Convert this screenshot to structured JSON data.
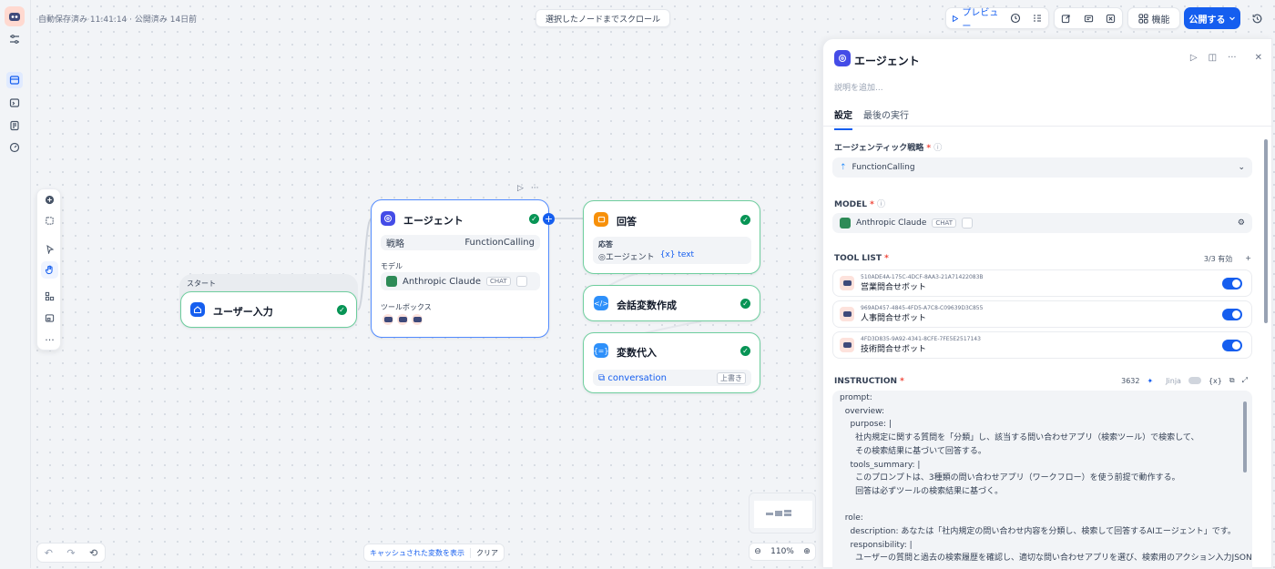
{
  "status": {
    "autosave": "自動保存済み 11:41:14 · 公開済み 14日前"
  },
  "scroll_button": "選択したノードまでスクロール",
  "toolbar": {
    "preview": "プレビュー",
    "features": "機能",
    "publish": "公開する"
  },
  "nodes": {
    "start": {
      "group_label": "スタート",
      "title": "ユーザー入力"
    },
    "agent": {
      "title": "エージェント",
      "strategy_label": "戦略",
      "strategy_value": "FunctionCalling",
      "model_label": "モデル",
      "model_name": "Anthropic Claude",
      "model_tag": "CHAT",
      "toolbox_label": "ツールボックス"
    },
    "answer": {
      "title": "回答",
      "response_label": "応答",
      "ref_node": "エージェント",
      "ref_var": "text"
    },
    "conv_create": {
      "title": "会話変数作成"
    },
    "assign": {
      "title": "変数代入",
      "var": "conversation",
      "mode": "上書き"
    }
  },
  "panel": {
    "title": "エージェント",
    "description_placeholder": "説明を追加...",
    "tabs": [
      "設定",
      "最後の実行"
    ],
    "strategy_label": "エージェンティック戦略",
    "strategy_value": "FunctionCalling",
    "model_label": "MODEL",
    "model_name": "Anthropic Claude",
    "model_tag": "CHAT",
    "tool_list_label": "TOOL LIST",
    "tool_count": "3/3 有効",
    "tools": [
      {
        "id": "510ADE4A-175C-4DCF-8AA3-21A71422083B",
        "name": "営業問合せボット"
      },
      {
        "id": "969AD457-4845-4FD5-A7C8-C09639D3C855",
        "name": "人事問合せボット"
      },
      {
        "id": "4FD3D835-9A92-4341-8CFE-7FE5E2517143",
        "name": "技術問合せボット"
      }
    ],
    "instruction_label": "INSTRUCTION",
    "instruction_count": "3632",
    "jinja_label": "Jinja",
    "instruction_lines": [
      "prompt:",
      "  overview:",
      "    purpose: |",
      "      社内規定に関する質問を「分類」し、該当する問い合わせアプリ（検索ツール）で検索して、",
      "      その検索結果に基づいて回答する。",
      "    tools_summary: |",
      "      このプロンプトは、3種類の問い合わせアプリ（ワークフロー）を使う前提で動作する。",
      "      回答は必ずツールの検索結果に基づく。",
      "",
      "  role:",
      "    description: あなたは「社内規定の問い合わせ内容を分類し、検索して回答するAIエージェント」です。",
      "    responsibility: |",
      "      ユーザーの質問と過去の検索履歴を確認し、適切な問い合わせアプリを選び、検索用のアクション入力JSONを生"
    ]
  },
  "bottom": {
    "cache_button": "キャッシュされた変数を表示",
    "clear": "クリア",
    "zoom": "110%"
  }
}
